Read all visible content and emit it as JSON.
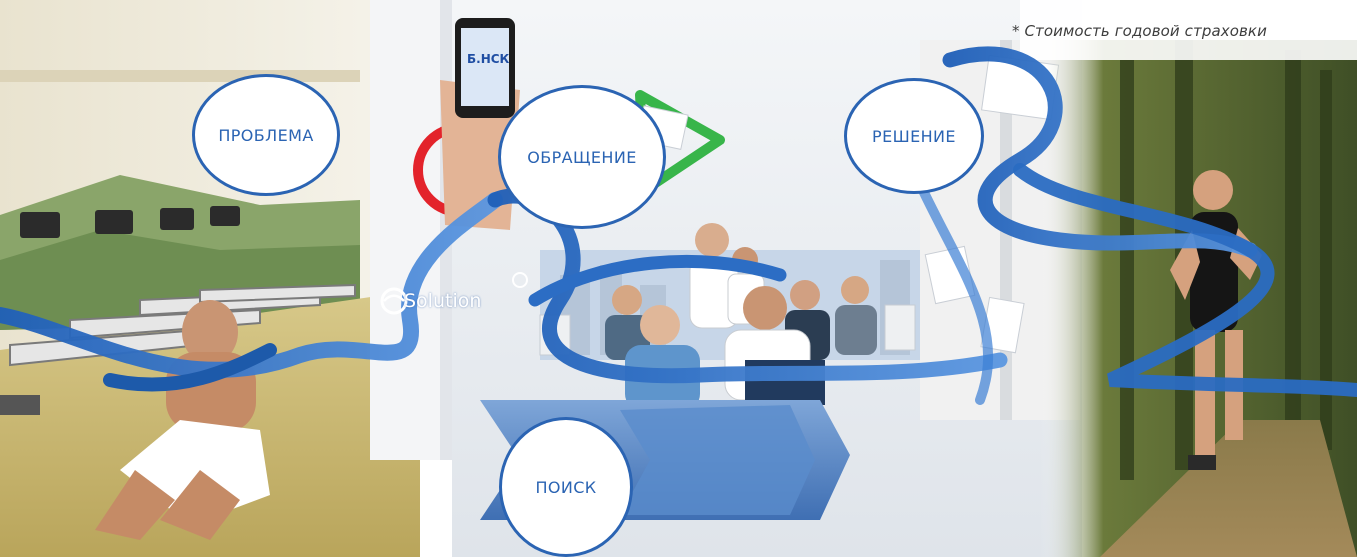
{
  "footnote": "* Стоимость годовой страховки",
  "steps": {
    "problem": "ПРОБЛЕМА",
    "request": "ОБРАЩЕНИЕ",
    "search": "ПОИСК",
    "solution": "РЕШЕНИЕ"
  },
  "brand": {
    "solution_logo": "Solution",
    "phone_screen": "Б.НСК"
  },
  "colors": {
    "accent": "#2b64b3",
    "ribbon": "#3a7bd5"
  }
}
